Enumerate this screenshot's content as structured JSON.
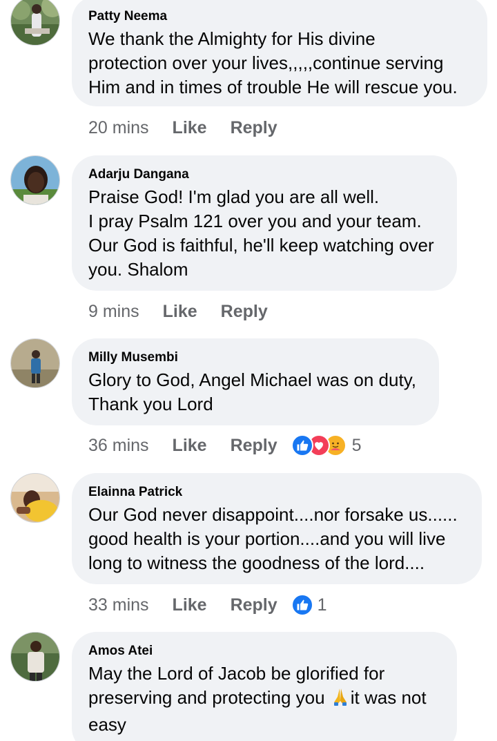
{
  "comments": [
    {
      "author": "Patty Neema",
      "lines": [
        "We thank the Almighty for His divine",
        "protection over your lives,,,,,continue serving",
        "Him and in times of trouble He will rescue you."
      ],
      "time": "20 mins",
      "like_label": "Like",
      "reply_label": "Reply",
      "avatar_icon": "profile-photo"
    },
    {
      "author": "Adarju Dangana",
      "lines": [
        "Praise God! I'm glad you are all well.",
        "I pray Psalm 121 over you and your team.",
        "Our God is faithful, he'll keep watching over",
        "you. Shalom"
      ],
      "time": "9 mins",
      "like_label": "Like",
      "reply_label": "Reply",
      "avatar_icon": "profile-photo"
    },
    {
      "author": "Milly Musembi",
      "lines": [
        "Glory to God, Angel Michael was on duty,",
        "Thank you Lord"
      ],
      "time": "36 mins",
      "like_label": "Like",
      "reply_label": "Reply",
      "reactions": [
        "like-icon",
        "love-icon",
        "care-icon"
      ],
      "reaction_count": "5",
      "avatar_icon": "profile-photo"
    },
    {
      "author": "Elainna Patrick",
      "lines": [
        "Our God never disappoint....nor forsake us......",
        "good health is your portion....and you will live",
        "long to witness the goodness of the lord...."
      ],
      "time": "33 mins",
      "like_label": "Like",
      "reply_label": "Reply",
      "reactions": [
        "like-icon"
      ],
      "reaction_count": "1",
      "avatar_icon": "profile-photo"
    },
    {
      "author": "Amos Atei",
      "lines": [
        "May the Lord of Jacob be glorified for",
        "preserving and protecting you",
        "easy"
      ],
      "line2_suffix": "it was not",
      "emoji": "folded-hands-icon",
      "avatar_icon": "profile-photo"
    }
  ],
  "colors": {
    "bubble": "#f0f2f5",
    "text": "#050505",
    "meta": "#65676b",
    "like_blue": "#1877f2",
    "love_red": "#f33e58",
    "care_yellow": "#f7b125"
  }
}
